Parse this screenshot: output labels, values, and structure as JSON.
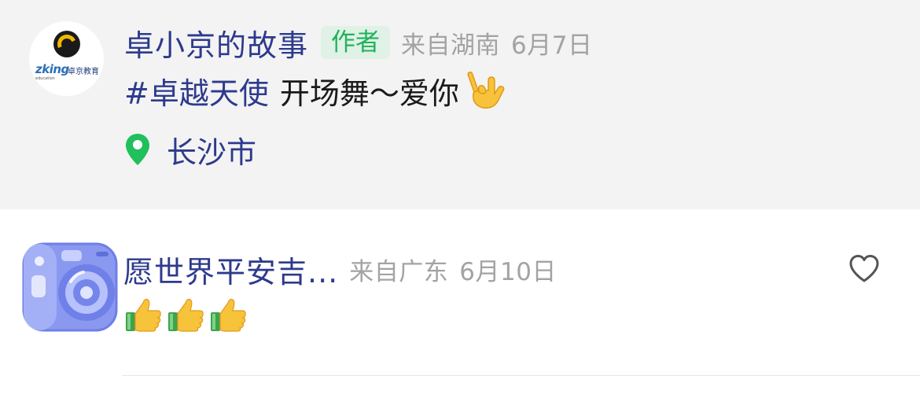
{
  "author_comment": {
    "avatar": {
      "icon": "zking-logo-icon",
      "logo_text": "zking",
      "logo_cn": "卓京教育",
      "logo_sub": "education"
    },
    "name": "卓小京的故事",
    "badge": "作者",
    "region": "来自湖南",
    "date": "6月7日",
    "hashtag": "#卓越天使",
    "text": "开场舞～爱你",
    "emoji": "love-you-gesture-emoji",
    "location_icon": "location-pin-icon",
    "location": "长沙市"
  },
  "reply_comment": {
    "avatar_icon": "instant-camera-icon",
    "name": "愿世界平安吉...",
    "region": "来自广东",
    "date": "6月10日",
    "like_icon": "heart-outline-icon",
    "emojis": [
      "thumbs-up-emoji",
      "thumbs-up-emoji",
      "thumbs-up-emoji"
    ]
  },
  "colors": {
    "name_blue": "#2d3a8c",
    "badge_green": "#20b35a",
    "badge_bg": "#e0f1e6",
    "meta_gray": "#a3a3a3",
    "top_bg": "#f3f3f3",
    "pin_green": "#20c05c"
  }
}
